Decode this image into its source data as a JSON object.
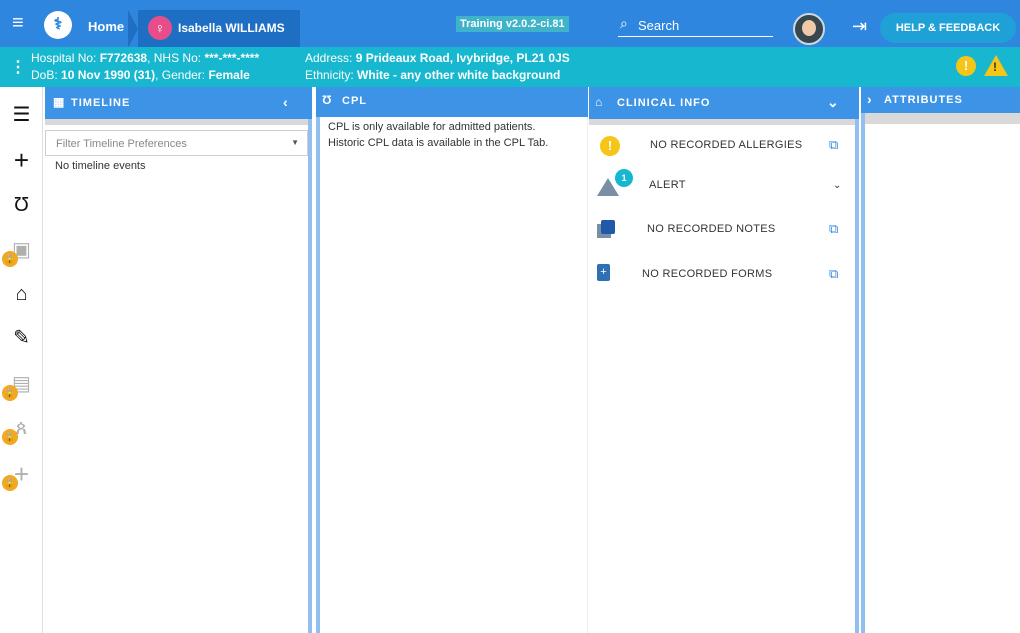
{
  "header": {
    "home_label": "Home",
    "patient_name": "Isabella WILLIAMS",
    "build": "Training v2.0.2-ci.81",
    "search_placeholder": "Search",
    "help_label": "HELP & FEEDBACK"
  },
  "patient": {
    "hospital_no_label": "Hospital No:",
    "hospital_no": "F772638",
    "nhs_no_label": "NHS No:",
    "nhs_no": "***-***-****",
    "dob_label": "DoB:",
    "dob": "10 Nov 1990 (31)",
    "gender_label": "Gender:",
    "gender": "Female",
    "address_label": "Address:",
    "address": "9 Prideaux Road, Ivybridge, PL21 0JS",
    "ethnicity_label": "Ethnicity:",
    "ethnicity": "White - any other white background"
  },
  "nav": {
    "items": [
      {
        "icon": "list-icon",
        "glyph": "☰",
        "locked": false
      },
      {
        "icon": "plus-icon",
        "glyph": "+",
        "locked": false
      },
      {
        "icon": "stethoscope-icon",
        "glyph": "Ʊ",
        "locked": false
      },
      {
        "icon": "camera-icon",
        "glyph": "▣",
        "locked": true
      },
      {
        "icon": "house-medical-icon",
        "glyph": "⌂",
        "locked": false
      },
      {
        "icon": "document-chart-icon",
        "glyph": "✎",
        "locked": false
      },
      {
        "icon": "clipboard-icon",
        "glyph": "▤",
        "locked": true
      },
      {
        "icon": "running-person-icon",
        "glyph": "ጰ",
        "locked": true
      },
      {
        "icon": "plus-add-icon",
        "glyph": "+",
        "locked": true
      }
    ]
  },
  "timeline": {
    "title": "TIMELINE",
    "filter_placeholder": "Filter Timeline Preferences",
    "empty_text": "No timeline events"
  },
  "cpl": {
    "title": "CPL",
    "message_1": "CPL is only available for admitted patients.",
    "message_2": "Historic CPL data is available in the CPL Tab."
  },
  "clinical": {
    "title": "CLINICAL INFO",
    "allergies_label": "NO RECORDED ALLERGIES",
    "alert_label": "ALERT",
    "alert_count": "1",
    "notes_label": "NO RECORDED NOTES",
    "forms_label": "NO RECORDED FORMS"
  },
  "attributes": {
    "title": "ATTRIBUTES"
  },
  "colors": {
    "header_blue": "#2e86de",
    "patient_banner": "#17b8cf",
    "warning": "#f5c518",
    "lock": "#f5a623"
  }
}
